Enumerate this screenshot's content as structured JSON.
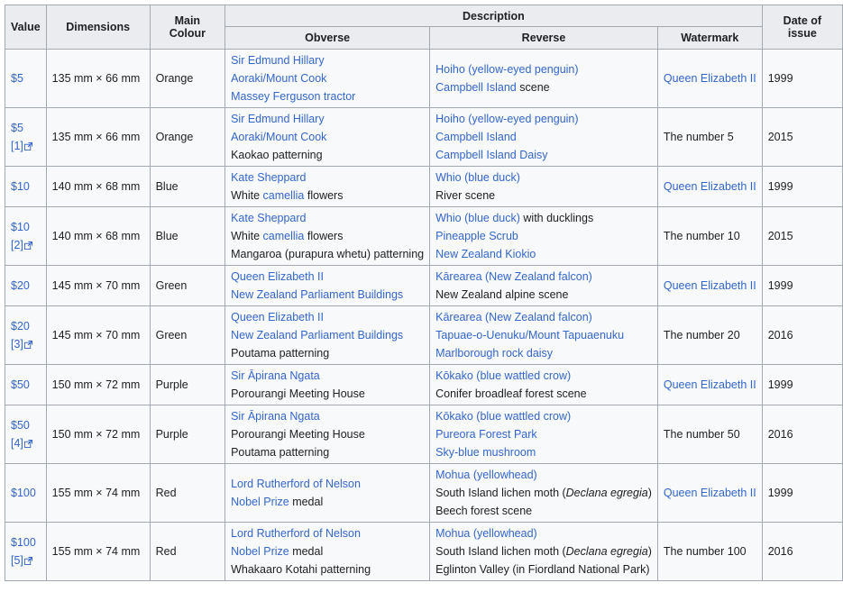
{
  "headers": {
    "value": "Value",
    "dimensions": "Dimensions",
    "colour": "Main Colour",
    "description": "Description",
    "obverse": "Obverse",
    "reverse": "Reverse",
    "watermark": "Watermark",
    "date": "Date of issue"
  },
  "icons": {
    "external_link": "external-link-icon"
  },
  "colors": {
    "link": "#3366cc",
    "header_bg": "#eaecf0",
    "cell_bg": "#f8f9fa",
    "border": "#a2a9b1"
  },
  "rows": [
    {
      "value": "$5",
      "ref": "",
      "dimensions": "135 mm × 66 mm",
      "colour": "Orange",
      "obverse": [
        [
          {
            "t": "Sir Edmund Hillary",
            "link": true
          }
        ],
        [
          {
            "t": "Aoraki/Mount Cook",
            "link": true
          }
        ],
        [
          {
            "t": "Massey Ferguson tractor",
            "link": true
          }
        ]
      ],
      "reverse": [
        [
          {
            "t": "Hoiho (yellow-eyed penguin)",
            "link": true
          }
        ],
        [
          {
            "t": "Campbell Island",
            "link": true
          },
          {
            "t": " scene",
            "link": false
          }
        ]
      ],
      "watermark": {
        "t": "Queen Elizabeth II",
        "link": true
      },
      "date": "1999"
    },
    {
      "value": "$5",
      "ref": "[1]",
      "dimensions": "135 mm × 66 mm",
      "colour": "Orange",
      "obverse": [
        [
          {
            "t": "Sir Edmund Hillary",
            "link": true
          }
        ],
        [
          {
            "t": "Aoraki/Mount Cook",
            "link": true
          }
        ],
        [
          {
            "t": "Kaokao patterning",
            "link": false
          }
        ]
      ],
      "reverse": [
        [
          {
            "t": "Hoiho (yellow-eyed penguin)",
            "link": true
          }
        ],
        [
          {
            "t": "Campbell Island",
            "link": true
          }
        ],
        [
          {
            "t": "Campbell Island Daisy",
            "link": true
          }
        ]
      ],
      "watermark": {
        "t": "The number 5",
        "link": false
      },
      "date": "2015"
    },
    {
      "value": "$10",
      "ref": "",
      "dimensions": "140 mm × 68 mm",
      "colour": "Blue",
      "obverse": [
        [
          {
            "t": "Kate Sheppard",
            "link": true
          }
        ],
        [
          {
            "t": "White ",
            "link": false
          },
          {
            "t": "camellia",
            "link": true
          },
          {
            "t": " flowers",
            "link": false
          }
        ]
      ],
      "reverse": [
        [
          {
            "t": "Whio (blue duck)",
            "link": true
          }
        ],
        [
          {
            "t": "River scene",
            "link": false
          }
        ]
      ],
      "watermark": {
        "t": "Queen Elizabeth II",
        "link": true
      },
      "date": "1999"
    },
    {
      "value": "$10",
      "ref": "[2]",
      "dimensions": "140 mm × 68 mm",
      "colour": "Blue",
      "obverse": [
        [
          {
            "t": "Kate Sheppard",
            "link": true
          }
        ],
        [
          {
            "t": "White ",
            "link": false
          },
          {
            "t": "camellia",
            "link": true
          },
          {
            "t": " flowers",
            "link": false
          }
        ],
        [
          {
            "t": "Mangaroa (purapura whetu) patterning",
            "link": false
          }
        ]
      ],
      "reverse": [
        [
          {
            "t": "Whio (blue duck)",
            "link": true
          },
          {
            "t": " with ducklings",
            "link": false
          }
        ],
        [
          {
            "t": "Pineapple Scrub",
            "link": true
          }
        ],
        [
          {
            "t": "New Zealand Kiokio",
            "link": true
          }
        ]
      ],
      "watermark": {
        "t": "The number 10",
        "link": false
      },
      "date": "2015"
    },
    {
      "value": "$20",
      "ref": "",
      "dimensions": "145 mm × 70 mm",
      "colour": "Green",
      "obverse": [
        [
          {
            "t": "Queen Elizabeth II",
            "link": true
          }
        ],
        [
          {
            "t": "New Zealand Parliament Buildings",
            "link": true
          }
        ]
      ],
      "reverse": [
        [
          {
            "t": "Kārearea (New Zealand falcon)",
            "link": true
          }
        ],
        [
          {
            "t": "New Zealand alpine scene",
            "link": false
          }
        ]
      ],
      "watermark": {
        "t": "Queen Elizabeth II",
        "link": true
      },
      "date": "1999"
    },
    {
      "value": "$20",
      "ref": "[3]",
      "dimensions": "145 mm × 70 mm",
      "colour": "Green",
      "obverse": [
        [
          {
            "t": "Queen Elizabeth II",
            "link": true
          }
        ],
        [
          {
            "t": "New Zealand Parliament Buildings",
            "link": true
          }
        ],
        [
          {
            "t": "Poutama patterning",
            "link": false
          }
        ]
      ],
      "reverse": [
        [
          {
            "t": "Kārearea (New Zealand falcon)",
            "link": true
          }
        ],
        [
          {
            "t": "Tapuae-o-Uenuku/Mount Tapuaenuku",
            "link": true
          }
        ],
        [
          {
            "t": "Marlborough rock daisy",
            "link": true
          }
        ]
      ],
      "watermark": {
        "t": "The number 20",
        "link": false
      },
      "date": "2016"
    },
    {
      "value": "$50",
      "ref": "",
      "dimensions": "150 mm × 72 mm",
      "colour": "Purple",
      "obverse": [
        [
          {
            "t": "Sir Āpirana Ngata",
            "link": true
          }
        ],
        [
          {
            "t": "Porourangi Meeting House",
            "link": false
          }
        ]
      ],
      "reverse": [
        [
          {
            "t": "Kōkako (blue wattled crow)",
            "link": true
          }
        ],
        [
          {
            "t": "Conifer broadleaf forest scene",
            "link": false
          }
        ]
      ],
      "watermark": {
        "t": "Queen Elizabeth II",
        "link": true
      },
      "date": "1999"
    },
    {
      "value": "$50",
      "ref": "[4]",
      "dimensions": "150 mm × 72 mm",
      "colour": "Purple",
      "obverse": [
        [
          {
            "t": "Sir Āpirana Ngata",
            "link": true
          }
        ],
        [
          {
            "t": "Porourangi Meeting House",
            "link": false
          }
        ],
        [
          {
            "t": "Poutama patterning",
            "link": false
          }
        ]
      ],
      "reverse": [
        [
          {
            "t": "Kōkako (blue wattled crow)",
            "link": true
          }
        ],
        [
          {
            "t": "Pureora Forest Park",
            "link": true
          }
        ],
        [
          {
            "t": "Sky-blue mushroom",
            "link": true
          }
        ]
      ],
      "watermark": {
        "t": "The number 50",
        "link": false
      },
      "date": "2016"
    },
    {
      "value": "$100",
      "ref": "",
      "dimensions": "155 mm × 74 mm",
      "colour": "Red",
      "obverse": [
        [
          {
            "t": "Lord Rutherford of Nelson",
            "link": true
          }
        ],
        [
          {
            "t": "Nobel Prize",
            "link": true
          },
          {
            "t": " medal",
            "link": false
          }
        ]
      ],
      "reverse": [
        [
          {
            "t": "Mohua (yellowhead)",
            "link": true
          }
        ],
        [
          {
            "t": "South Island lichen moth (",
            "link": false
          },
          {
            "t": "Declana egregia",
            "link": false,
            "italic": true
          },
          {
            "t": ")",
            "link": false
          }
        ],
        [
          {
            "t": "Beech forest scene",
            "link": false
          }
        ]
      ],
      "watermark": {
        "t": "Queen Elizabeth II",
        "link": true
      },
      "date": "1999"
    },
    {
      "value": "$100",
      "ref": "[5]",
      "dimensions": "155 mm × 74 mm",
      "colour": "Red",
      "obverse": [
        [
          {
            "t": "Lord Rutherford of Nelson",
            "link": true
          }
        ],
        [
          {
            "t": "Nobel Prize",
            "link": true
          },
          {
            "t": " medal",
            "link": false
          }
        ],
        [
          {
            "t": "Whakaaro Kotahi patterning",
            "link": false
          }
        ]
      ],
      "reverse": [
        [
          {
            "t": "Mohua (yellowhead)",
            "link": true
          }
        ],
        [
          {
            "t": "South Island lichen moth (",
            "link": false
          },
          {
            "t": "Declana egregia",
            "link": false,
            "italic": true
          },
          {
            "t": ")",
            "link": false
          }
        ],
        [
          {
            "t": "Eglinton Valley (in Fiordland National Park)",
            "link": false
          }
        ]
      ],
      "watermark": {
        "t": "The number 100",
        "link": false
      },
      "date": "2016"
    }
  ]
}
